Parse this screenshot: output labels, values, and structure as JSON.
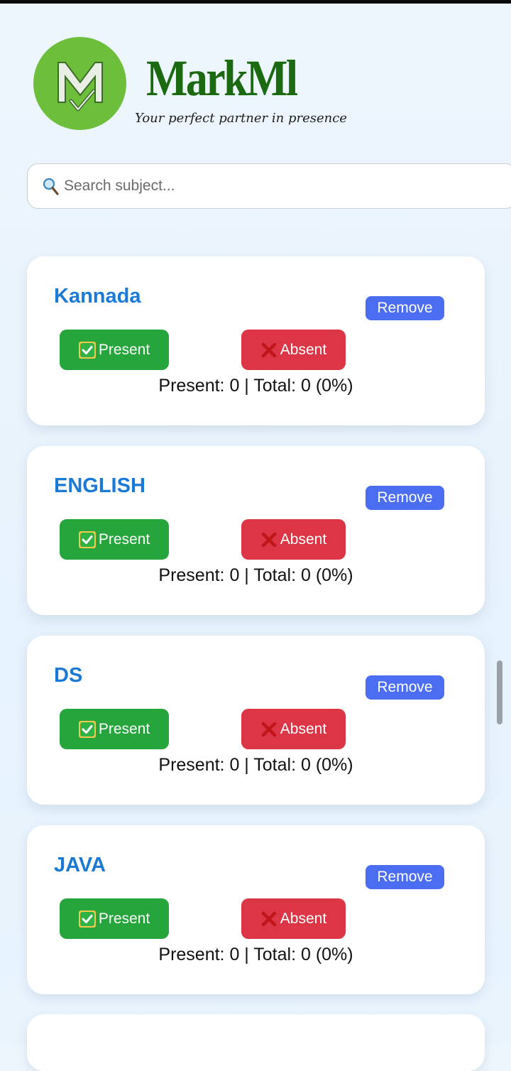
{
  "app": {
    "title": "MarkMl",
    "tagline": "Your perfect partner in presence",
    "logo_letter": "M"
  },
  "search": {
    "placeholder": "Search subject...",
    "value": "",
    "icon": "magnifier-icon"
  },
  "subjects": [
    {
      "name": "Kannada",
      "remove_label": "Remove",
      "present_label": "Present",
      "absent_label": "Absent",
      "stats": "Present: 0 | Total: 0 (0%)"
    },
    {
      "name": "ENGLISH",
      "remove_label": "Remove",
      "present_label": "Present",
      "absent_label": "Absent",
      "stats": "Present: 0 | Total: 0 (0%)"
    },
    {
      "name": "DS",
      "remove_label": "Remove",
      "present_label": "Present",
      "absent_label": "Absent",
      "stats": "Present: 0 | Total: 0 (0%)"
    },
    {
      "name": "JAVA",
      "remove_label": "Remove",
      "present_label": "Present",
      "absent_label": "Absent",
      "stats": "Present: 0 | Total: 0 (0%)"
    }
  ],
  "icons": {
    "present": "check-mark-icon",
    "absent": "cross-mark-icon"
  },
  "colors": {
    "brand_green": "#1b6a12",
    "logo_green": "#6dbf3b",
    "subject_blue": "#1a7ad6",
    "remove_blue": "#4a6df2",
    "present_green": "#25a53b",
    "absent_red": "#dc3545"
  }
}
